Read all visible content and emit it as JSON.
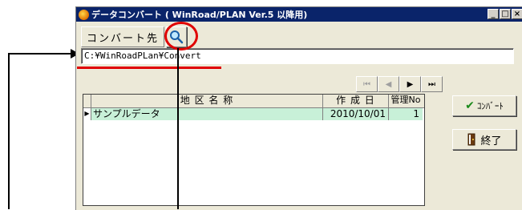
{
  "window": {
    "title": "データコンバート ( WinRoad/PLAN Ver.5 以降用)",
    "controls": [
      "_",
      "□",
      "×"
    ]
  },
  "convert_dest": {
    "label": "コンバート先",
    "browse_icon": "magnifier-icon"
  },
  "path": {
    "value": "C:¥WinRoadPLan¥Convert"
  },
  "navigator": {
    "first": "⏮",
    "prev": "◀",
    "next": "▶",
    "last": "⏭"
  },
  "grid": {
    "columns": [
      "地 区 名 称",
      "作 成 日",
      "管理No"
    ],
    "rows": [
      {
        "name": "サンプルデータ",
        "date": "2010/10/01",
        "no": "1"
      }
    ],
    "indicator": "▶"
  },
  "buttons": {
    "convert": {
      "label": "ｺﾝﾊﾞｰﾄ",
      "icon": "checkmark-icon"
    },
    "exit": {
      "label": "終了",
      "icon": "exit-door-icon"
    }
  },
  "colors": {
    "titlebar": "#0a246a",
    "selected_row": "#c8f0d8",
    "annotation": "#e00000"
  }
}
